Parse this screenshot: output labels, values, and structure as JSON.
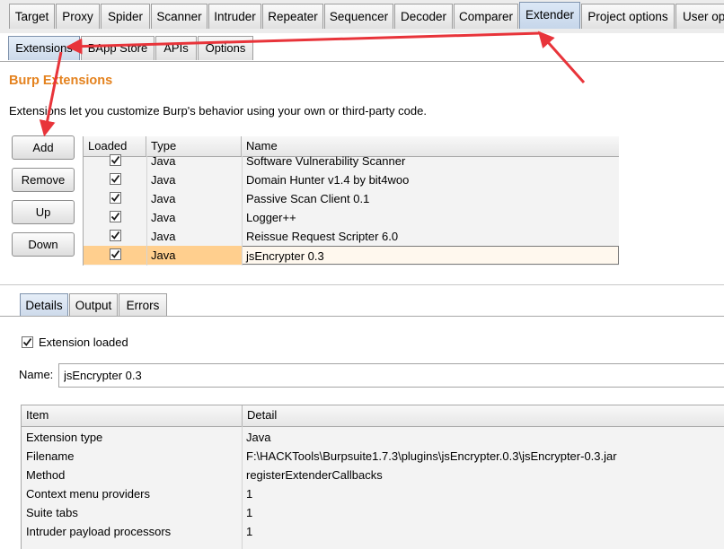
{
  "top_tabs": [
    {
      "label": "Target",
      "selected": false
    },
    {
      "label": "Proxy",
      "selected": false
    },
    {
      "label": "Spider",
      "selected": false
    },
    {
      "label": "Scanner",
      "selected": false
    },
    {
      "label": "Intruder",
      "selected": false
    },
    {
      "label": "Repeater",
      "selected": false
    },
    {
      "label": "Sequencer",
      "selected": false
    },
    {
      "label": "Decoder",
      "selected": false
    },
    {
      "label": "Comparer",
      "selected": false
    },
    {
      "label": "Extender",
      "selected": true
    },
    {
      "label": "Project options",
      "selected": false
    },
    {
      "label": "User op",
      "selected": false
    }
  ],
  "sub_tabs": [
    {
      "label": "Extensions",
      "selected": true
    },
    {
      "label": "BApp Store",
      "selected": false
    },
    {
      "label": "APIs",
      "selected": false
    },
    {
      "label": "Options",
      "selected": false
    }
  ],
  "section": {
    "title": "Burp Extensions",
    "description": "Extensions let you customize Burp's behavior using your own or third-party code."
  },
  "buttons": {
    "add": "Add",
    "remove": "Remove",
    "up": "Up",
    "down": "Down"
  },
  "extensions_table": {
    "headers": {
      "loaded": "Loaded",
      "type": "Type",
      "name": "Name"
    },
    "rows": [
      {
        "loaded": true,
        "type": "Java",
        "name": "Software Vulnerability Scanner",
        "selected": false
      },
      {
        "loaded": true,
        "type": "Java",
        "name": "Domain Hunter v1.4 by bit4woo",
        "selected": false
      },
      {
        "loaded": true,
        "type": "Java",
        "name": "Passive Scan Client 0.1",
        "selected": false
      },
      {
        "loaded": true,
        "type": "Java",
        "name": "Logger++",
        "selected": false
      },
      {
        "loaded": true,
        "type": "Java",
        "name": "Reissue Request Scripter 6.0",
        "selected": false
      },
      {
        "loaded": true,
        "type": "Java",
        "name": "jsEncrypter 0.3",
        "selected": true
      }
    ]
  },
  "detail_tabs": [
    {
      "label": "Details",
      "selected": true
    },
    {
      "label": "Output",
      "selected": false
    },
    {
      "label": "Errors",
      "selected": false
    }
  ],
  "details": {
    "extension_loaded_label": "Extension loaded",
    "extension_loaded": true,
    "name_label": "Name:",
    "name_value": "jsEncrypter 0.3",
    "table_headers": {
      "item": "Item",
      "detail": "Detail"
    },
    "rows": [
      {
        "item": "Extension type",
        "detail": "Java"
      },
      {
        "item": "Filename",
        "detail": "F:\\HACKTools\\Burpsuite1.7.3\\plugins\\jsEncrypter.0.3\\jsEncrypter-0.3.jar"
      },
      {
        "item": "Method",
        "detail": "registerExtenderCallbacks"
      },
      {
        "item": "Context menu providers",
        "detail": "1"
      },
      {
        "item": "Suite tabs",
        "detail": "1"
      },
      {
        "item": "Intruder payload processors",
        "detail": "1"
      }
    ]
  },
  "colors": {
    "heading": "#e4821e",
    "selection": "#ffcf8e",
    "annotation_arrow": "#e8343a"
  }
}
